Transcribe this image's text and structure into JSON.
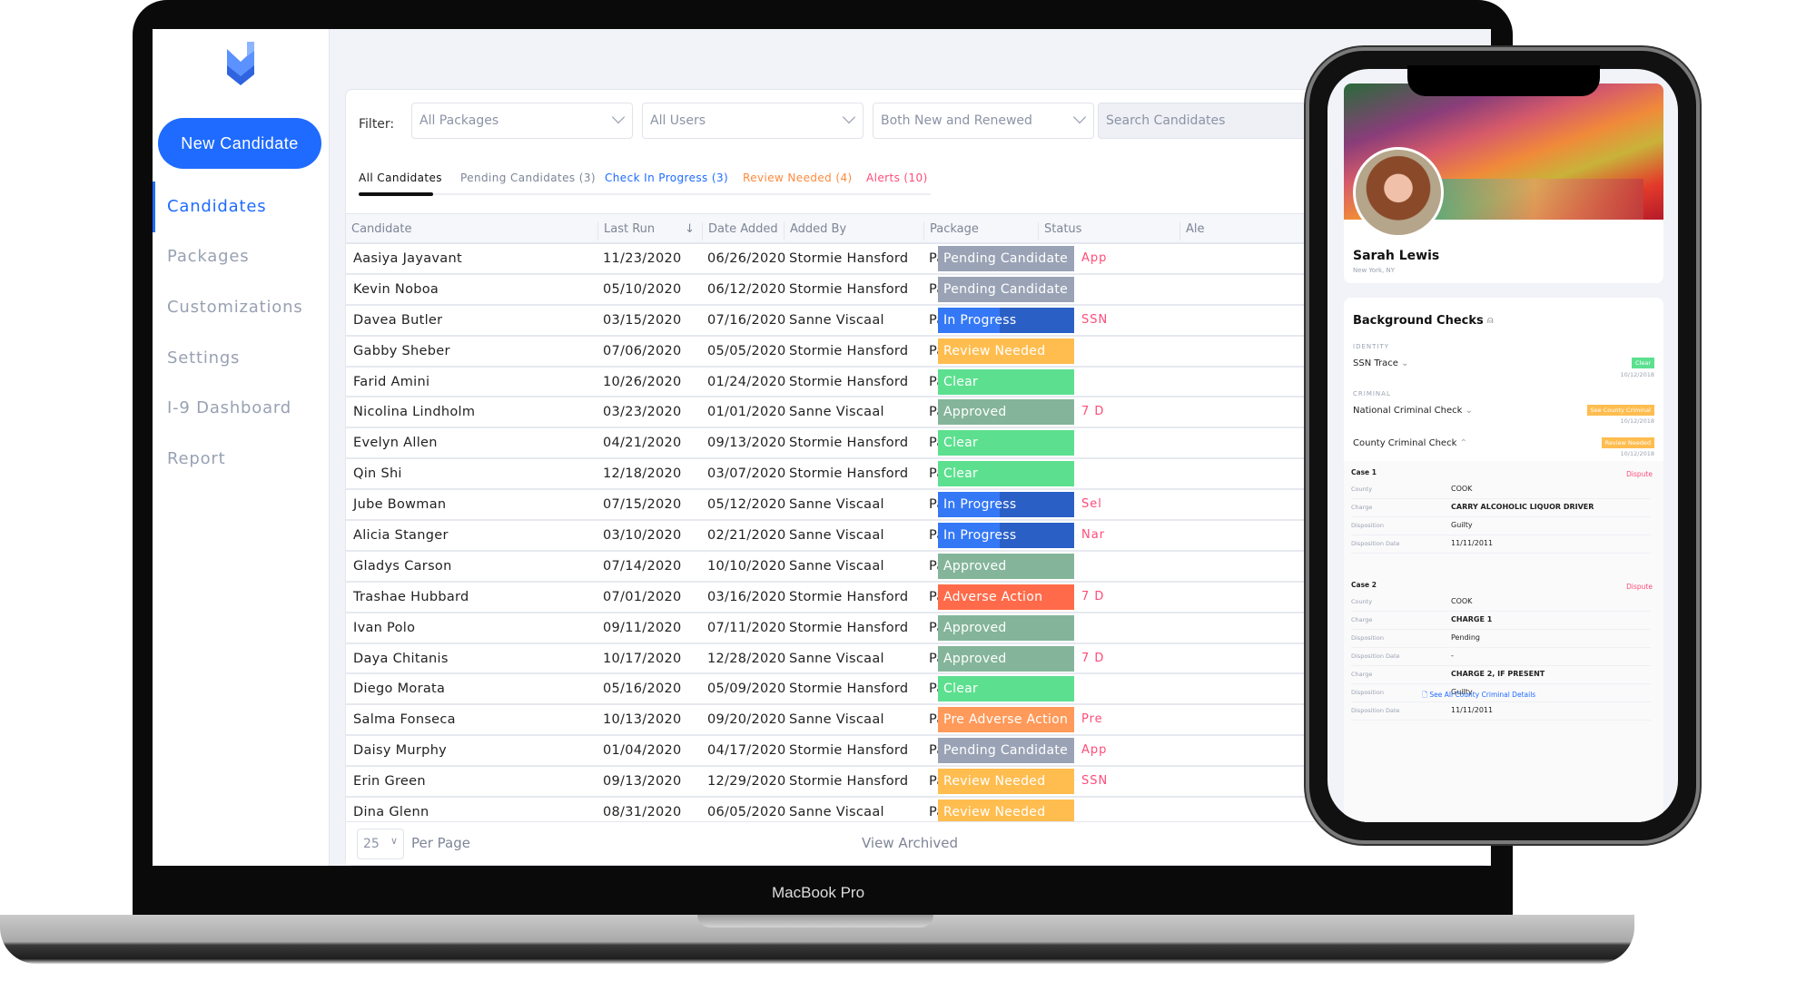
{
  "device_label": "MacBook Pro",
  "colors": {
    "accent": "#1f6bff",
    "pending": "#9aa3b5",
    "in_progress": "#2a5fc6",
    "review": "#ffbd4f",
    "clear": "#5ce08f",
    "approved": "#84b59a",
    "adverse": "#ff6b4a",
    "pre_adverse": "#ff9a5a",
    "alert": "#ff4c78"
  },
  "sidebar": {
    "logo_icon": "chevron-shield-logo",
    "new_button": "New Candidate",
    "items": [
      {
        "label": "Candidates",
        "active": true
      },
      {
        "label": "Packages"
      },
      {
        "label": "Customizations"
      },
      {
        "label": "Settings"
      },
      {
        "label": "I-9 Dashboard"
      },
      {
        "label": "Report"
      }
    ]
  },
  "filter": {
    "label": "Filter:",
    "packages": "All Packages",
    "users": "All Users",
    "type": "Both New and Renewed",
    "search_placeholder": "Search Candidates"
  },
  "tabs": [
    {
      "label": "All Candidates",
      "color": "#111111",
      "active": true
    },
    {
      "label": "Pending Candidates (3)",
      "color": "#7d8597"
    },
    {
      "label": "Check In Progress (3)",
      "color": "#1f6bff"
    },
    {
      "label": "Review Needed (4)",
      "color": "#ff8a3d"
    },
    {
      "label": "Alerts (10)",
      "color": "#ff4c78"
    }
  ],
  "table": {
    "columns": [
      "Candidate",
      "Last Run",
      "Date Added",
      "Added By",
      "Package",
      "Status",
      "Ale"
    ],
    "sort_icon": "arrow-down-icon",
    "rows": [
      {
        "name": "Aasiya Jayavant",
        "last_run": "11/23/2020",
        "added": "06/26/2020",
        "by": "Stormie Hansford",
        "package": "Painters Premium",
        "status": "Pending Candidate",
        "kind": "pending",
        "alert": "App"
      },
      {
        "name": "Kevin Noboa",
        "last_run": "05/10/2020",
        "added": "06/12/2020",
        "by": "Stormie Hansford",
        "package": "Painters Premium",
        "status": "Pending Candidate",
        "kind": "pending",
        "alert": ""
      },
      {
        "name": "Davea Butler",
        "last_run": "03/15/2020",
        "added": "07/16/2020",
        "by": "Sanne Viscaal",
        "package": "Painters Premium",
        "status": "In Progress",
        "kind": "in_progress",
        "progress": 0.45,
        "alert": "SSN"
      },
      {
        "name": "Gabby Sheber",
        "last_run": "07/06/2020",
        "added": "05/05/2020",
        "by": "Stormie Hansford",
        "package": "Painters Basic",
        "status": "Review Needed",
        "kind": "review",
        "alert": ""
      },
      {
        "name": "Farid Amini",
        "last_run": "10/26/2020",
        "added": "01/24/2020",
        "by": "Stormie Hansford",
        "package": "Painters Basic",
        "status": "Clear",
        "kind": "clear",
        "alert": ""
      },
      {
        "name": "Nicolina Lindholm",
        "last_run": "03/23/2020",
        "added": "01/01/2020",
        "by": "Sanne Viscaal",
        "package": "Painters Basic",
        "status": "Approved",
        "kind": "approved",
        "alert": "7 D"
      },
      {
        "name": "Evelyn Allen",
        "last_run": "04/21/2020",
        "added": "09/13/2020",
        "by": "Stormie Hansford",
        "package": "Painters Premium",
        "status": "Clear",
        "kind": "clear",
        "alert": ""
      },
      {
        "name": "Qin Shi",
        "last_run": "12/18/2020",
        "added": "03/07/2020",
        "by": "Stormie Hansford",
        "package": "Painters Premium",
        "status": "Clear",
        "kind": "clear",
        "alert": ""
      },
      {
        "name": "Jube Bowman",
        "last_run": "07/15/2020",
        "added": "05/12/2020",
        "by": "Sanne Viscaal",
        "package": "Painters Premium",
        "status": "In Progress",
        "kind": "in_progress",
        "progress": 0.45,
        "alert": "Sel"
      },
      {
        "name": "Alicia Stanger",
        "last_run": "03/10/2020",
        "added": "02/21/2020",
        "by": "Sanne Viscaal",
        "package": "Painters Basic",
        "status": "In Progress",
        "kind": "in_progress",
        "progress": 0.45,
        "alert": "Nar"
      },
      {
        "name": "Gladys Carson",
        "last_run": "07/14/2020",
        "added": "10/10/2020",
        "by": "Sanne Viscaal",
        "package": "Painters Premium",
        "status": "Approved",
        "kind": "approved",
        "alert": ""
      },
      {
        "name": "Trashae Hubbard",
        "last_run": "07/01/2020",
        "added": "03/16/2020",
        "by": "Stormie Hansford",
        "package": "Painters Basic",
        "status": "Adverse Action",
        "kind": "adverse",
        "alert": "7 D"
      },
      {
        "name": "Ivan Polo",
        "last_run": "09/11/2020",
        "added": "07/11/2020",
        "by": "Stormie Hansford",
        "package": "Painters Basic",
        "status": "Approved",
        "kind": "approved",
        "alert": ""
      },
      {
        "name": "Daya Chitanis",
        "last_run": "10/17/2020",
        "added": "12/28/2020",
        "by": "Sanne Viscaal",
        "package": "Painters Basic",
        "status": "Approved",
        "kind": "approved",
        "alert": "7 D"
      },
      {
        "name": "Diego Morata",
        "last_run": "05/16/2020",
        "added": "05/09/2020",
        "by": "Stormie Hansford",
        "package": "Painters Basic",
        "status": "Clear",
        "kind": "clear",
        "alert": ""
      },
      {
        "name": "Salma Fonseca",
        "last_run": "10/13/2020",
        "added": "09/20/2020",
        "by": "Sanne Viscaal",
        "package": "Painters Premium",
        "status": "Pre Adverse Action",
        "kind": "pre_adverse",
        "alert": "Pre"
      },
      {
        "name": "Daisy Murphy",
        "last_run": "01/04/2020",
        "added": "04/17/2020",
        "by": "Stormie Hansford",
        "package": "Painters Premium",
        "status": "Pending Candidate",
        "kind": "pending",
        "alert": "App"
      },
      {
        "name": "Erin Green",
        "last_run": "09/13/2020",
        "added": "12/29/2020",
        "by": "Stormie Hansford",
        "package": "Painters Basic",
        "status": "Review Needed",
        "kind": "review",
        "alert": "SSN"
      },
      {
        "name": "Dina Glenn",
        "last_run": "08/31/2020",
        "added": "06/05/2020",
        "by": "Sanne Viscaal",
        "package": "Painters Basic",
        "status": "Review Needed",
        "kind": "review",
        "alert": ""
      }
    ]
  },
  "footer": {
    "per_page_value": "25",
    "per_page_label": "Per Page",
    "view_archived": "View Archived"
  },
  "phone": {
    "name": "Sarah Lewis",
    "location": "New York, NY",
    "section_title": "Background Checks",
    "identity_label": "IDENTITY",
    "criminal_label": "CRIMINAL",
    "checks": [
      {
        "name": "SSN Trace",
        "badge": "Clear",
        "badge_color": "#5ce08f",
        "date": "10/12/2018"
      },
      {
        "name": "National Criminal Check",
        "badge": "See County Criminal",
        "badge_color": "#ffbd4f",
        "date": "10/12/2018"
      },
      {
        "name": "County Criminal Check",
        "badge": "Review Needed",
        "badge_color": "#ffbd4f",
        "date": "10/12/2018"
      }
    ],
    "dispute_label": "Dispute",
    "cases": [
      {
        "title": "Case 1",
        "fields": [
          [
            "County",
            "COOK"
          ],
          [
            "Charge",
            "CARRY ALCOHOLIC LIQUOR DRIVER"
          ],
          [
            "Disposition",
            "Guilty"
          ],
          [
            "Disposition Date",
            "11/11/2011"
          ]
        ]
      },
      {
        "title": "Case 2",
        "fields": [
          [
            "County",
            "COOK"
          ],
          [
            "Charge",
            "CHARGE 1"
          ],
          [
            "Disposition",
            "Pending"
          ],
          [
            "Disposition Date",
            "-"
          ],
          [
            "Charge",
            "CHARGE 2, IF PRESENT"
          ],
          [
            "Disposition",
            "Guilty"
          ],
          [
            "Disposition Date",
            "11/11/2011"
          ]
        ]
      }
    ],
    "see_all_link": "See All County Criminal Details"
  }
}
